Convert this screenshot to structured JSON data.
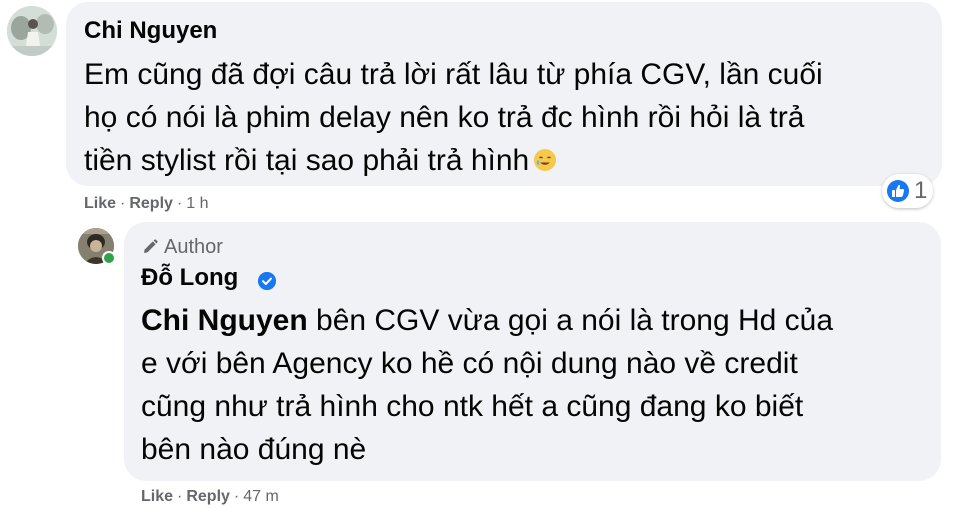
{
  "comments": [
    {
      "author": "Chi Nguyen",
      "text": "Em cũng đã đợi câu trả lời rất lâu từ phía CGV, lần cuối\nhọ có nói là phim delay nên ko trả đc hình rồi hỏi là trả\ntiền stylist rồi tại sao phải trả hình",
      "emoji": "tear-smile-emoji",
      "actions": {
        "like": "Like",
        "reply": "Reply",
        "time": "1 h"
      },
      "reaction": {
        "icon": "like-icon",
        "count": "1"
      }
    },
    {
      "badge": "Author",
      "author": "Đỗ Long",
      "verified": true,
      "mention": "Chi Nguyen",
      "text": " bên CGV vừa gọi a nói là trong Hd của\ne với bên Agency ko hề có nội dung nào về credit\ncũng như trả hình cho ntk hết a cũng đang ko biết\nbên nào đúng nè",
      "actions": {
        "like": "Like",
        "reply": "Reply",
        "time": "47 m"
      }
    }
  ],
  "separator": "·",
  "colors": {
    "bubble": "#f0f2f5",
    "secondary_text": "#65676b",
    "verified": "#1877f2",
    "like": "#1877f2",
    "online": "#31a24c"
  }
}
